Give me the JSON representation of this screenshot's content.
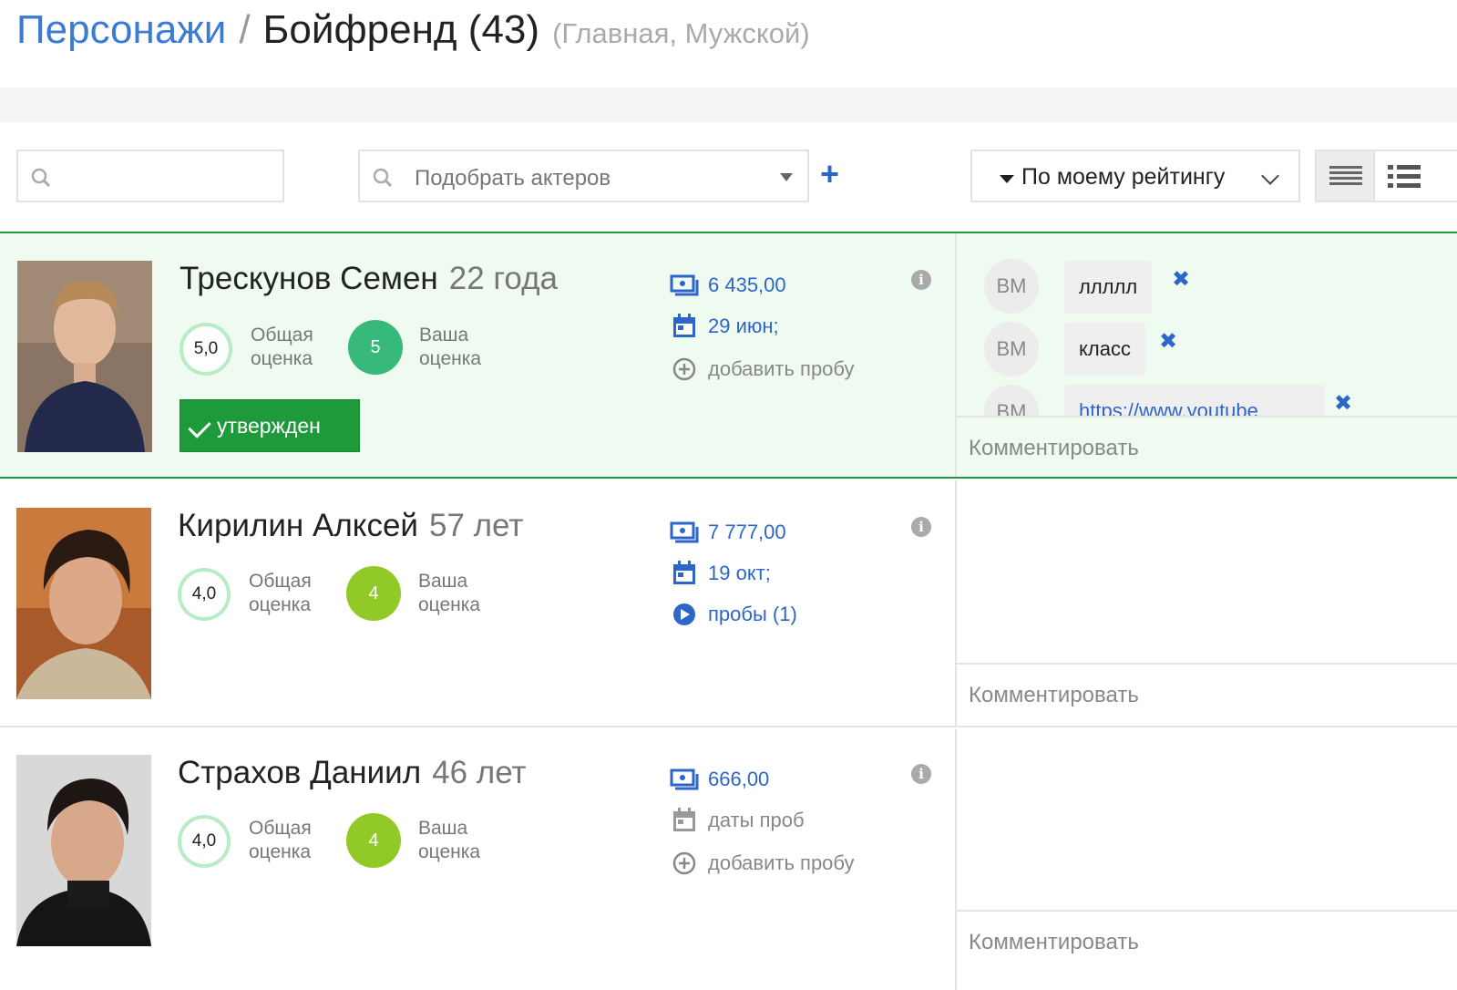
{
  "header": {
    "breadcrumb_link": "Персонажи",
    "separator": "/",
    "title": "Бойфренд (43)",
    "subtitle": "(Главная, Мужской)"
  },
  "toolbar": {
    "search_placeholder": "",
    "cast_placeholder": "Подобрать актеров",
    "add_icon": "plus-icon",
    "sort_label": "По моему рейтингу",
    "view_list_icon": "list-icon",
    "view_bullets_icon": "bulleted-list-icon"
  },
  "labels": {
    "overall_1": "Общая",
    "overall_2": "оценка",
    "yours_1": "Ваша",
    "yours_2": "оценка",
    "comment_placeholder": "Комментировать",
    "info": "i"
  },
  "actors": [
    {
      "name": "Трескунов Семен",
      "age": "22 года",
      "overall_rating": "5,0",
      "your_rating": "5",
      "status": "утвержден",
      "fee": "6 435,00",
      "date": "29 июн;",
      "tryout": "добавить пробу",
      "comments": [
        {
          "author": "ВМ",
          "text": "ллллл"
        },
        {
          "author": "ВМ",
          "text": "класс"
        },
        {
          "author": "ВМ",
          "text": "https://www.youtube"
        }
      ]
    },
    {
      "name": "Кирилин Алксей",
      "age": "57 лет",
      "overall_rating": "4,0",
      "your_rating": "4",
      "fee": "7 777,00",
      "date": "19 окт;",
      "tryout": "пробы (1)"
    },
    {
      "name": "Страхов Даниил",
      "age": "46 лет",
      "overall_rating": "4,0",
      "your_rating": "4",
      "fee": "666,00",
      "date": "даты проб",
      "tryout": "добавить пробу"
    }
  ],
  "colors": {
    "link_blue": "#3b7bd4",
    "action_blue": "#2d66c9",
    "approved_green": "#1e9a3b",
    "rating_green": "#36b97a",
    "rating_lime": "#91c926",
    "selected_row_bg": "#effbf1"
  }
}
